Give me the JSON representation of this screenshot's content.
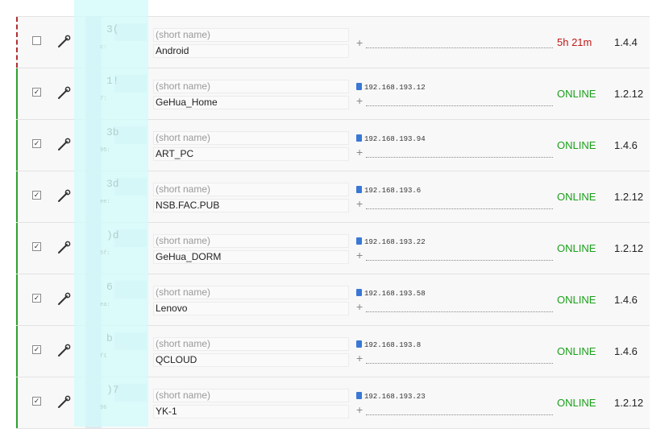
{
  "ui": {
    "short_name_placeholder": "(short name)"
  },
  "rows": [
    {
      "checked": false,
      "id_fragment": "3(",
      "id_sub_fragment": "c:",
      "name": "Android",
      "ip": "",
      "status": "5h 21m",
      "status_kind": "offline",
      "version": "1.4.4"
    },
    {
      "checked": true,
      "id_fragment": "1!",
      "id_sub_fragment": "7:",
      "name": "GeHua_Home",
      "ip": "192.168.193.12",
      "status": "ONLINE",
      "status_kind": "online",
      "version": "1.2.12"
    },
    {
      "checked": true,
      "id_fragment": "3b",
      "id_sub_fragment": "95:",
      "name": "ART_PC",
      "ip": "192.168.193.94",
      "status": "ONLINE",
      "status_kind": "online",
      "version": "1.4.6"
    },
    {
      "checked": true,
      "id_fragment": "3d",
      "id_sub_fragment": "ee:",
      "name": "NSB.FAC.PUB",
      "ip": "192.168.193.6",
      "status": "ONLINE",
      "status_kind": "online",
      "version": "1.2.12"
    },
    {
      "checked": true,
      "id_fragment": ")d",
      "id_sub_fragment": "5f:",
      "name": "GeHua_DORM",
      "ip": "192.168.193.22",
      "status": "ONLINE",
      "status_kind": "online",
      "version": "1.2.12"
    },
    {
      "checked": true,
      "id_fragment": "6",
      "id_sub_fragment": "ea:",
      "name": "Lenovo",
      "ip": "192.168.193.58",
      "status": "ONLINE",
      "status_kind": "online",
      "version": "1.4.6"
    },
    {
      "checked": true,
      "id_fragment": "b",
      "id_sub_fragment": "f1",
      "name": "QCLOUD",
      "ip": "192.168.193.8",
      "status": "ONLINE",
      "status_kind": "online",
      "version": "1.4.6"
    },
    {
      "checked": true,
      "id_fragment": ")7",
      "id_sub_fragment": "96",
      "name": "YK-1",
      "ip": "192.168.193.23",
      "status": "ONLINE",
      "status_kind": "online",
      "version": "1.2.12"
    }
  ]
}
